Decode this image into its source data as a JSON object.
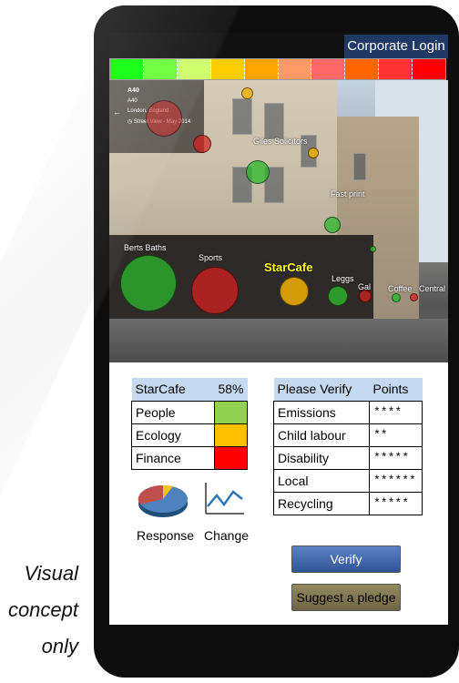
{
  "caption": {
    "line1": "Visual",
    "line2": "concept",
    "line3": "only"
  },
  "header": {
    "login_label": "Corporate Login"
  },
  "rating_scale": [
    "#00ff00",
    "#66ff33",
    "#ccff66",
    "#ffcc00",
    "#ffa500",
    "#ff9966",
    "#ff6666",
    "#ff6600",
    "#ff3333",
    "#ff0000"
  ],
  "streetview": {
    "road": "A40",
    "road_sub": "A40",
    "place": "London, England",
    "date": "Street View - May 2014"
  },
  "businesses": [
    {
      "name": "Giles Solicitors",
      "color": "#2db82d"
    },
    {
      "name": "Fast print",
      "color": "#2db82d"
    },
    {
      "name": "Berts Baths",
      "color": "#2db82d"
    },
    {
      "name": "Sports",
      "color": "#d42020"
    },
    {
      "name": "StarCafe",
      "color": "#f0b000",
      "selected": true
    },
    {
      "name": "Leggs",
      "color": "#2db82d"
    },
    {
      "name": "Gal",
      "color": "#d42020"
    },
    {
      "name": "Coffee",
      "color": "#2db82d"
    },
    {
      "name": "Central",
      "color": "#d42020"
    }
  ],
  "scorecard": {
    "title": "StarCafe",
    "score": "58%",
    "rows": [
      {
        "label": "People",
        "color": "#92d050"
      },
      {
        "label": "Ecology",
        "color": "#ffc000"
      },
      {
        "label": "Finance",
        "color": "#ff0000"
      }
    ]
  },
  "verify": {
    "header_label": "Please Verify",
    "header_points": "Points",
    "rows": [
      {
        "label": "Emissions",
        "points": "****"
      },
      {
        "label": "Child labour",
        "points": "**"
      },
      {
        "label": "Disability",
        "points": "*****"
      },
      {
        "label": "Local",
        "points": "******"
      },
      {
        "label": "Recycling",
        "points": "*****"
      }
    ]
  },
  "actions": {
    "response_label": "Response",
    "change_label": "Change",
    "verify_button": "Verify",
    "pledge_button": "Suggest a pledge"
  }
}
